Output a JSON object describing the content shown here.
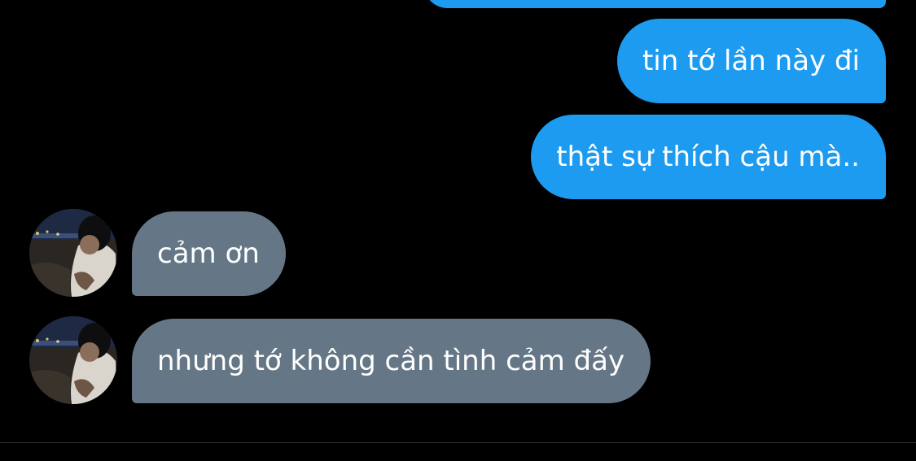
{
  "conversation": {
    "messages": [
      {
        "sender": "me",
        "text": ""
      },
      {
        "sender": "me",
        "text": "tin tớ lần này đi"
      },
      {
        "sender": "me",
        "text": "thật sự thích cậu mà.."
      },
      {
        "sender": "other",
        "text": "cảm ơn"
      },
      {
        "sender": "other",
        "text": "nhưng tớ không cần tình cảm đấy"
      }
    ]
  },
  "colors": {
    "background": "#000000",
    "sent_bubble": "#1d9bf0",
    "received_bubble": "#657786",
    "divider": "#2f3336"
  },
  "icons": {
    "avatar": "user-photo-avatar"
  }
}
